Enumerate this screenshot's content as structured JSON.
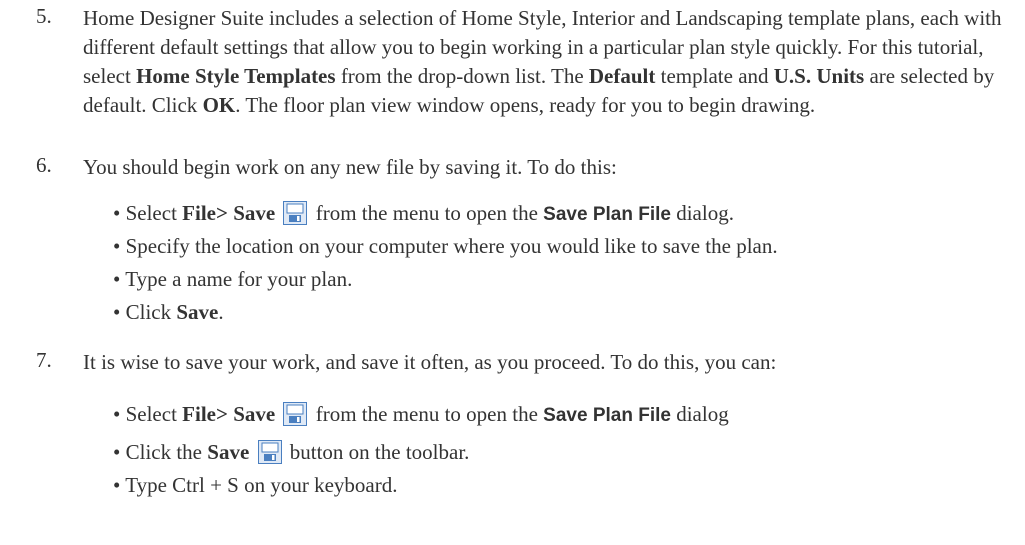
{
  "step5": {
    "num": "5.",
    "t1": "Home Designer Suite includes a selection of Home Style, Interior and Landscaping template plans, each with different default settings that allow you to begin working in a particular plan style quickly. For this tutorial, select ",
    "b1": "Home Style Templates",
    "t2": " from the drop-down list. The ",
    "b2": "Default",
    "t3": " template and ",
    "b3": "U.S. Units",
    "t4": " are selected by default. Click ",
    "b4": "OK",
    "t5": ". The floor plan view window opens, ready for you to begin drawing."
  },
  "step6": {
    "num": "6.",
    "text": "You should begin work on any new file by saving it. To do this:",
    "bullets": {
      "b1": {
        "pre": "• Select ",
        "bold": "File> Save",
        "mid": " from the menu to open the ",
        "sans": "Save Plan File",
        "post": " dialog."
      },
      "b2": {
        "text": "• Specify the location on your computer where you would like to save the plan."
      },
      "b3": {
        "text": "• Type a name for your plan."
      },
      "b4": {
        "pre": "• Click ",
        "bold": "Save",
        "post": "."
      }
    }
  },
  "step7": {
    "num": "7.",
    "text": "It is wise to save your work, and save it often, as you proceed. To do this, you can:",
    "bullets": {
      "b1": {
        "pre": "• Select ",
        "bold": "File> Save",
        "mid": " from the menu to open the ",
        "sans": "Save Plan File",
        "post": " dialog"
      },
      "b2": {
        "pre": "• Click the ",
        "bold": "Save",
        "post": " button on the toolbar."
      },
      "b3": {
        "text": "• Type Ctrl + S on your keyboard."
      }
    }
  },
  "icons": {
    "save": "save-floppy-icon",
    "save_color": "#4a7fc0"
  }
}
